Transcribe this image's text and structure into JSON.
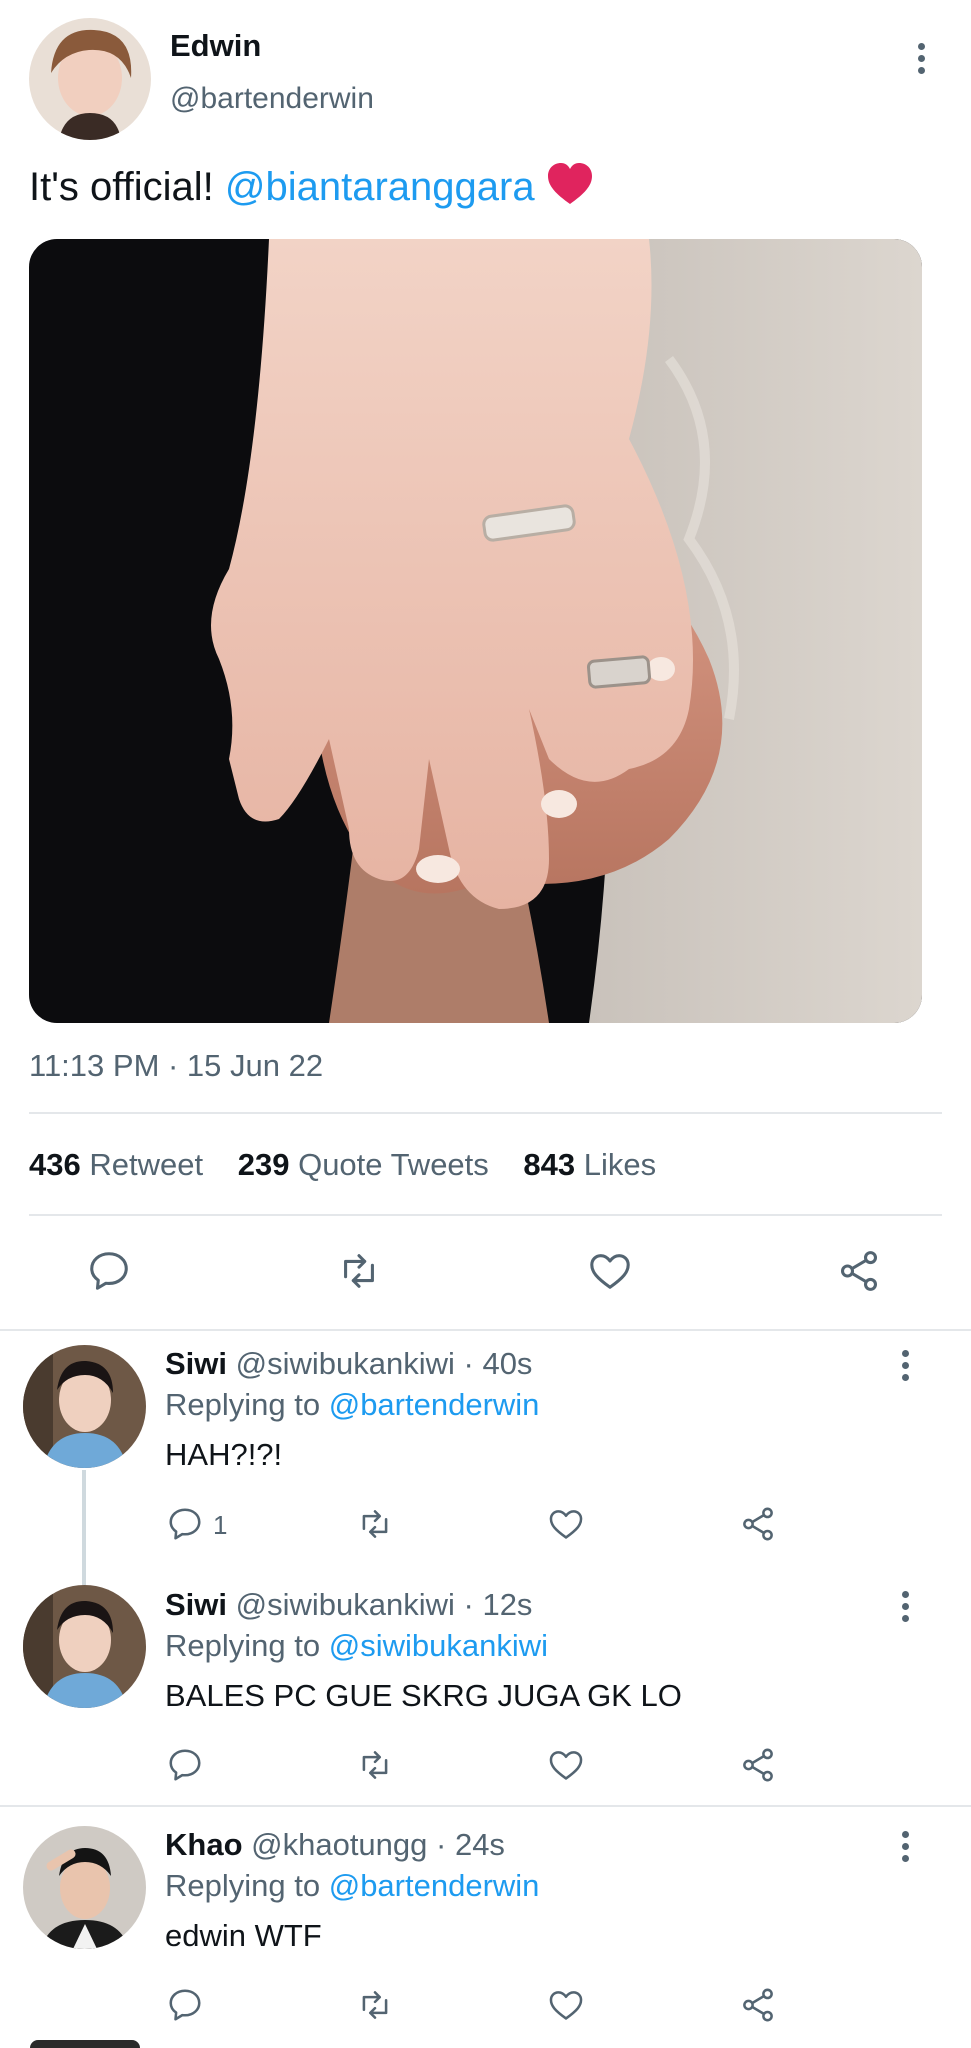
{
  "tweet": {
    "author_name": "Edwin",
    "author_handle": "@bartenderwin",
    "text_prefix": "It's official! ",
    "mention": "@biantaranggara",
    "emoji": "❤️",
    "timestamp": "11:13 PM · 15 Jun 22",
    "stats": {
      "retweets_count": "436",
      "retweets_label": "Retweet",
      "quotes_count": "239",
      "quotes_label": "Quote Tweets",
      "likes_count": "843",
      "likes_label": "Likes"
    },
    "image_icon": "photo-of-holding-hands-with-rings"
  },
  "actions": [
    "reply-icon",
    "retweet-icon",
    "like-icon",
    "share-icon"
  ],
  "replies": [
    {
      "name": "Siwi",
      "handle": "@siwibukankiwi",
      "time": " · 40s",
      "replying_prefix": "Replying to ",
      "replying_to": "@bartenderwin",
      "text": "HAH?!?!",
      "reply_count": "1"
    },
    {
      "name": "Siwi",
      "handle": "@siwibukankiwi",
      "time": " · 12s",
      "replying_prefix": "Replying to ",
      "replying_to": "@siwibukankiwi",
      "text": "BALES PC GUE SKRG JUGA GK LO",
      "reply_count": ""
    },
    {
      "name": "Khao",
      "handle": "@khaotungg",
      "time": " · 24s",
      "replying_prefix": "Replying to ",
      "replying_to": "@bartenderwin",
      "text": "edwin WTF",
      "reply_count": ""
    }
  ],
  "colors": {
    "link": "#1d9bf0",
    "muted": "#536471",
    "heart": "#e0245e",
    "divider": "#e4e7ea"
  }
}
